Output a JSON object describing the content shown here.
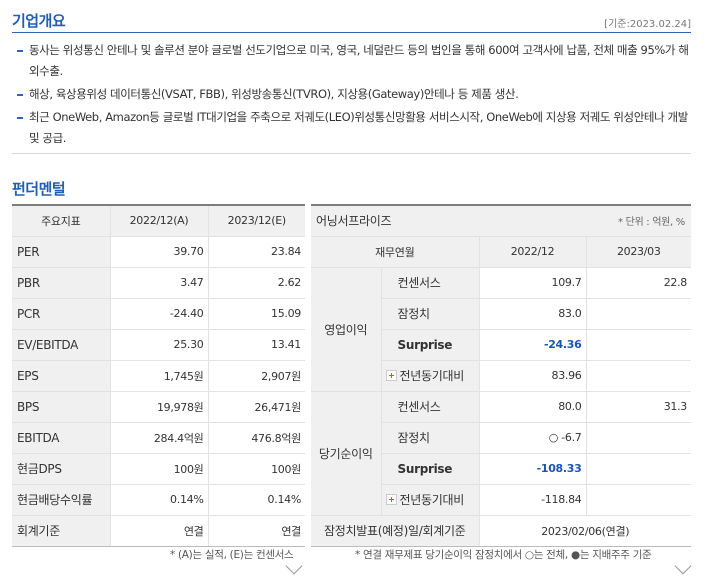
{
  "overview": {
    "title": "기업개요",
    "basis": "[기준:2023.02.24]",
    "items": [
      "동사는 위성통신 안테나 및 솔루션 분야 글로벌 선도기업으로 미국, 영국, 네덜란드 등의 법인을 통해 600여 고객사에 납품, 전체 매출 95%가 해외수출.",
      "해상, 육상용위성 데이터통신(VSAT, FBB), 위성방송통신(TVRO), 지상용(Gateway)안테나 등 제품 생산.",
      "최근 OneWeb, Amazon등 글로벌 IT대기업을 주축으로 저궤도(LEO)위성통신망활용 서비스시작, OneWeb에 지상용 저궤도 위성안테나 개발 및 공급."
    ]
  },
  "fundamental": {
    "title": "펀더멘털",
    "headers": [
      "주요지표",
      "2022/12(A)",
      "2023/12(E)"
    ],
    "rows": [
      {
        "label": "PER",
        "a": "39.70",
        "e": "23.84"
      },
      {
        "label": "PBR",
        "a": "3.47",
        "e": "2.62"
      },
      {
        "label": "PCR",
        "a": "-24.40",
        "e": "15.09"
      },
      {
        "label": "EV/EBITDA",
        "a": "25.30",
        "e": "13.41"
      },
      {
        "label": "EPS",
        "a": "1,745원",
        "e": "2,907원"
      },
      {
        "label": "BPS",
        "a": "19,978원",
        "e": "26,471원"
      },
      {
        "label": "EBITDA",
        "a": "284.4억원",
        "e": "476.8억원"
      },
      {
        "label": "현금DPS",
        "a": "100원",
        "e": "100원"
      },
      {
        "label": "현금배당수익률",
        "a": "0.14%",
        "e": "0.14%"
      },
      {
        "label": "회계기준",
        "a": "연결",
        "e": "연결"
      }
    ],
    "note": "* (A)는 실적, (E)는 컨센서스"
  },
  "earnings": {
    "title": "어닝서프라이즈",
    "unit": "* 단위 : 억원, %",
    "headers": [
      "재무연월",
      "2022/12",
      "2023/03"
    ],
    "groups": [
      {
        "name": "영업이익",
        "rows": [
          {
            "label": "컨센서스",
            "v1": "109.7",
            "v2": "22.8"
          },
          {
            "label": "잠정치",
            "v1": "83.0",
            "v2": ""
          },
          {
            "label": "Surprise",
            "v1": "-24.36",
            "v2": ""
          },
          {
            "label": "전년동기대비",
            "v1": "83.96",
            "v2": ""
          }
        ]
      },
      {
        "name": "당기순이익",
        "rows": [
          {
            "label": "컨센서스",
            "v1": "80.0",
            "v2": "31.3"
          },
          {
            "label": "잠정치",
            "v1": "○ -6.7",
            "v2": ""
          },
          {
            "label": "Surprise",
            "v1": "-108.33",
            "v2": ""
          },
          {
            "label": "전년동기대비",
            "v1": "-118.84",
            "v2": ""
          }
        ]
      }
    ],
    "footer_label": "잠정치발표(예정)일/회계기준",
    "footer_value": "2023/02/06(연결)",
    "note": "* 연결 재무제표 당기순이익 잠정치에서 ○는 전체, ●는 지배주주 기준"
  }
}
